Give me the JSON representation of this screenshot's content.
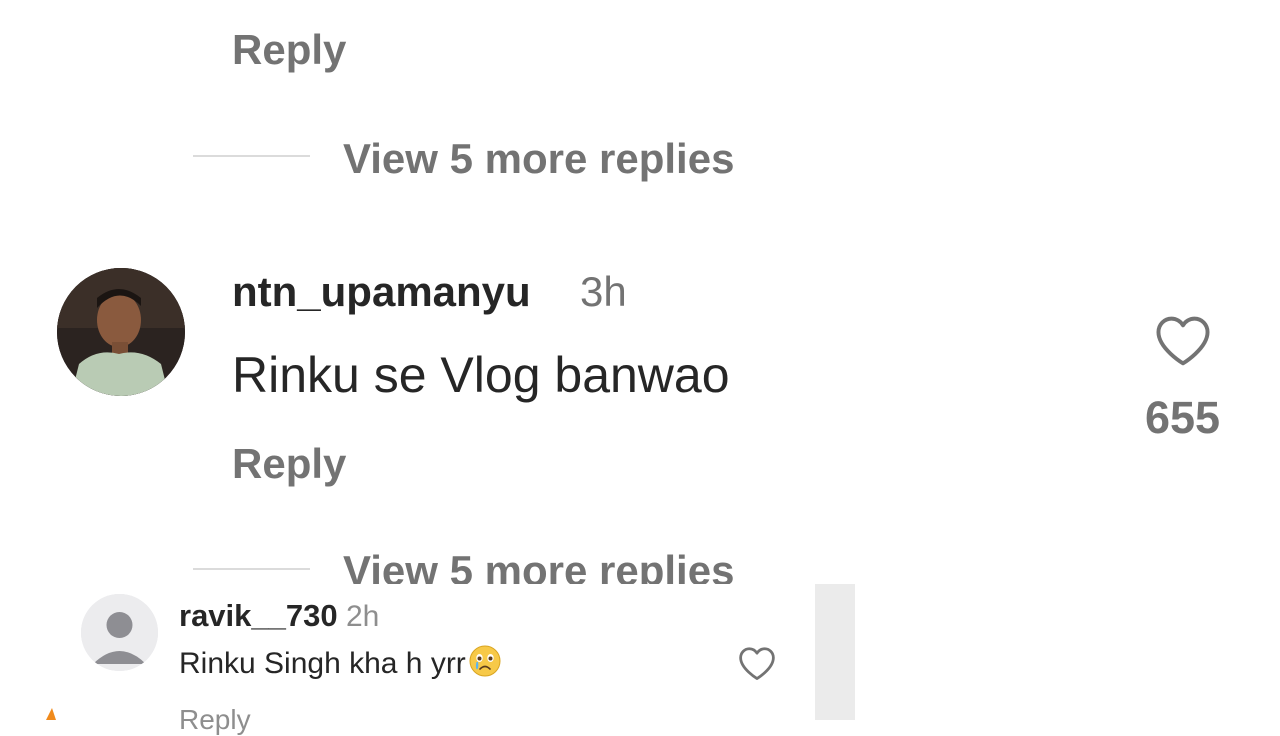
{
  "thread": {
    "reply_label_top": "Reply",
    "view_more_top": "View 5 more replies",
    "view_more_bottom": "View 5 more replies"
  },
  "comment_main": {
    "username": "ntn_upamanyu",
    "time": "3h",
    "text": "Rinku se Vlog banwao",
    "reply_label": "Reply",
    "likes": "655",
    "icon": "heart-outline-icon"
  },
  "comment_overlay": {
    "username": "ravik__730",
    "time": "2h",
    "text": "Rinku Singh kha h yrr",
    "emoji": "crying-face",
    "reply_label": "Reply",
    "icon": "heart-outline-icon"
  },
  "colors": {
    "text_primary": "#262626",
    "text_secondary": "#737373",
    "divider": "#dbdbdb"
  }
}
